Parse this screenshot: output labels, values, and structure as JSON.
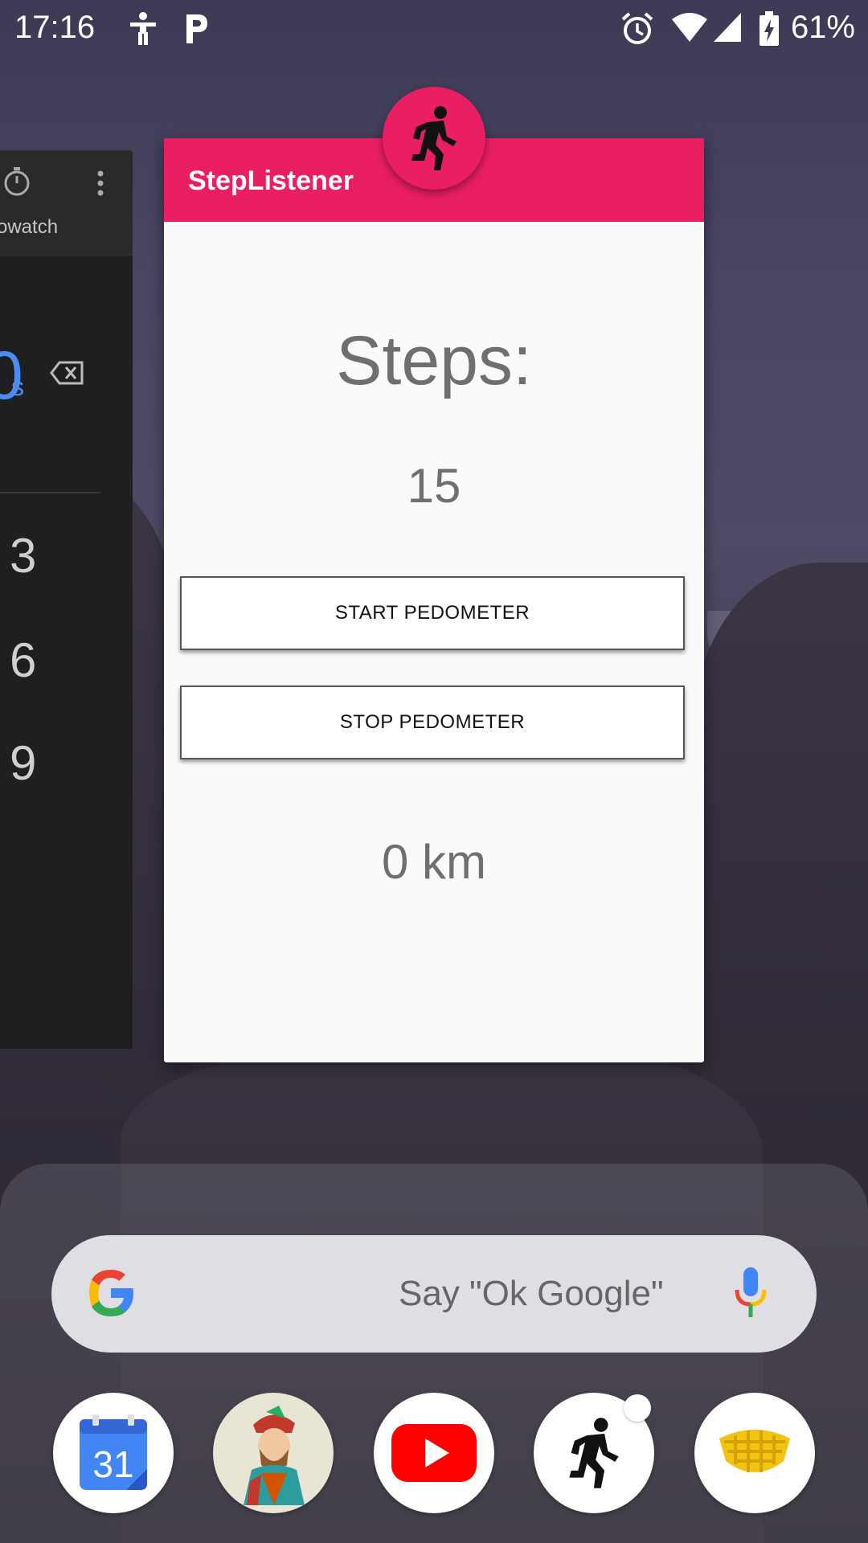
{
  "status_bar": {
    "time": "17:16",
    "battery": "61%",
    "icons": [
      "accessibility-icon",
      "parking-icon",
      "alarm-icon",
      "wifi-icon",
      "signal-icon",
      "battery-charging-icon"
    ]
  },
  "recents": {
    "left_card": {
      "title": "owatch",
      "digits": [
        "3",
        "6",
        "9"
      ],
      "partial_value": "0",
      "unit": "s"
    },
    "app_card": {
      "app_name": "StepListener",
      "steps_label": "Steps:",
      "steps_value": "15",
      "start_button": "START PEDOMETER",
      "stop_button": "STOP PEDOMETER",
      "distance": "0 km",
      "accent_color": "#e91e63"
    }
  },
  "home": {
    "search_hint": "Say \"Ok Google\"",
    "dock_apps": [
      {
        "name": "calendar-icon",
        "label": "31"
      },
      {
        "name": "playing-cards-icon"
      },
      {
        "name": "youtube-icon"
      },
      {
        "name": "steplistener-icon"
      },
      {
        "name": "hive-icon"
      }
    ]
  }
}
